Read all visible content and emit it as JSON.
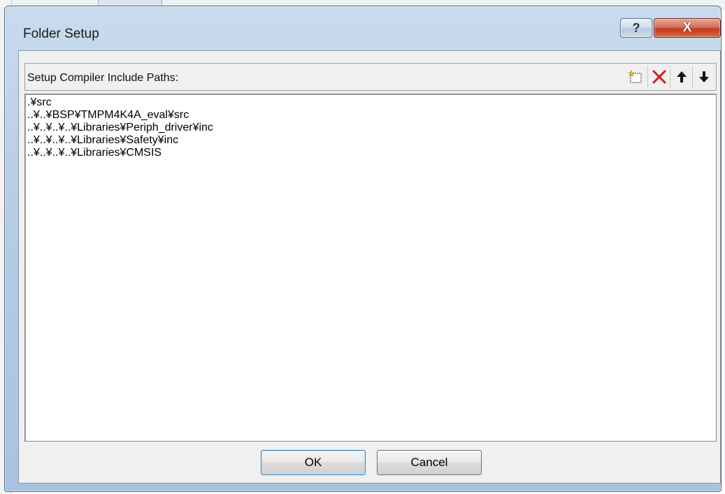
{
  "window": {
    "title": "Folder Setup",
    "help_glyph": "?",
    "close_glyph": "X"
  },
  "toolbar": {
    "label": "Setup Compiler Include Paths:",
    "icons": [
      "new-folder-icon",
      "delete-icon",
      "move-up-icon",
      "move-down-icon"
    ]
  },
  "paths": [
    ".¥src",
    "..¥..¥BSP¥TMPM4K4A_eval¥src",
    "..¥..¥..¥..¥Libraries¥Periph_driver¥inc",
    "..¥..¥..¥..¥Libraries¥Safety¥inc",
    "..¥..¥..¥..¥Libraries¥CMSIS"
  ],
  "buttons": {
    "ok": "OK",
    "cancel": "Cancel"
  },
  "colors": {
    "frame": "#b7cde6",
    "close_button": "#c23a1f",
    "delete_icon": "#d11a1a"
  }
}
